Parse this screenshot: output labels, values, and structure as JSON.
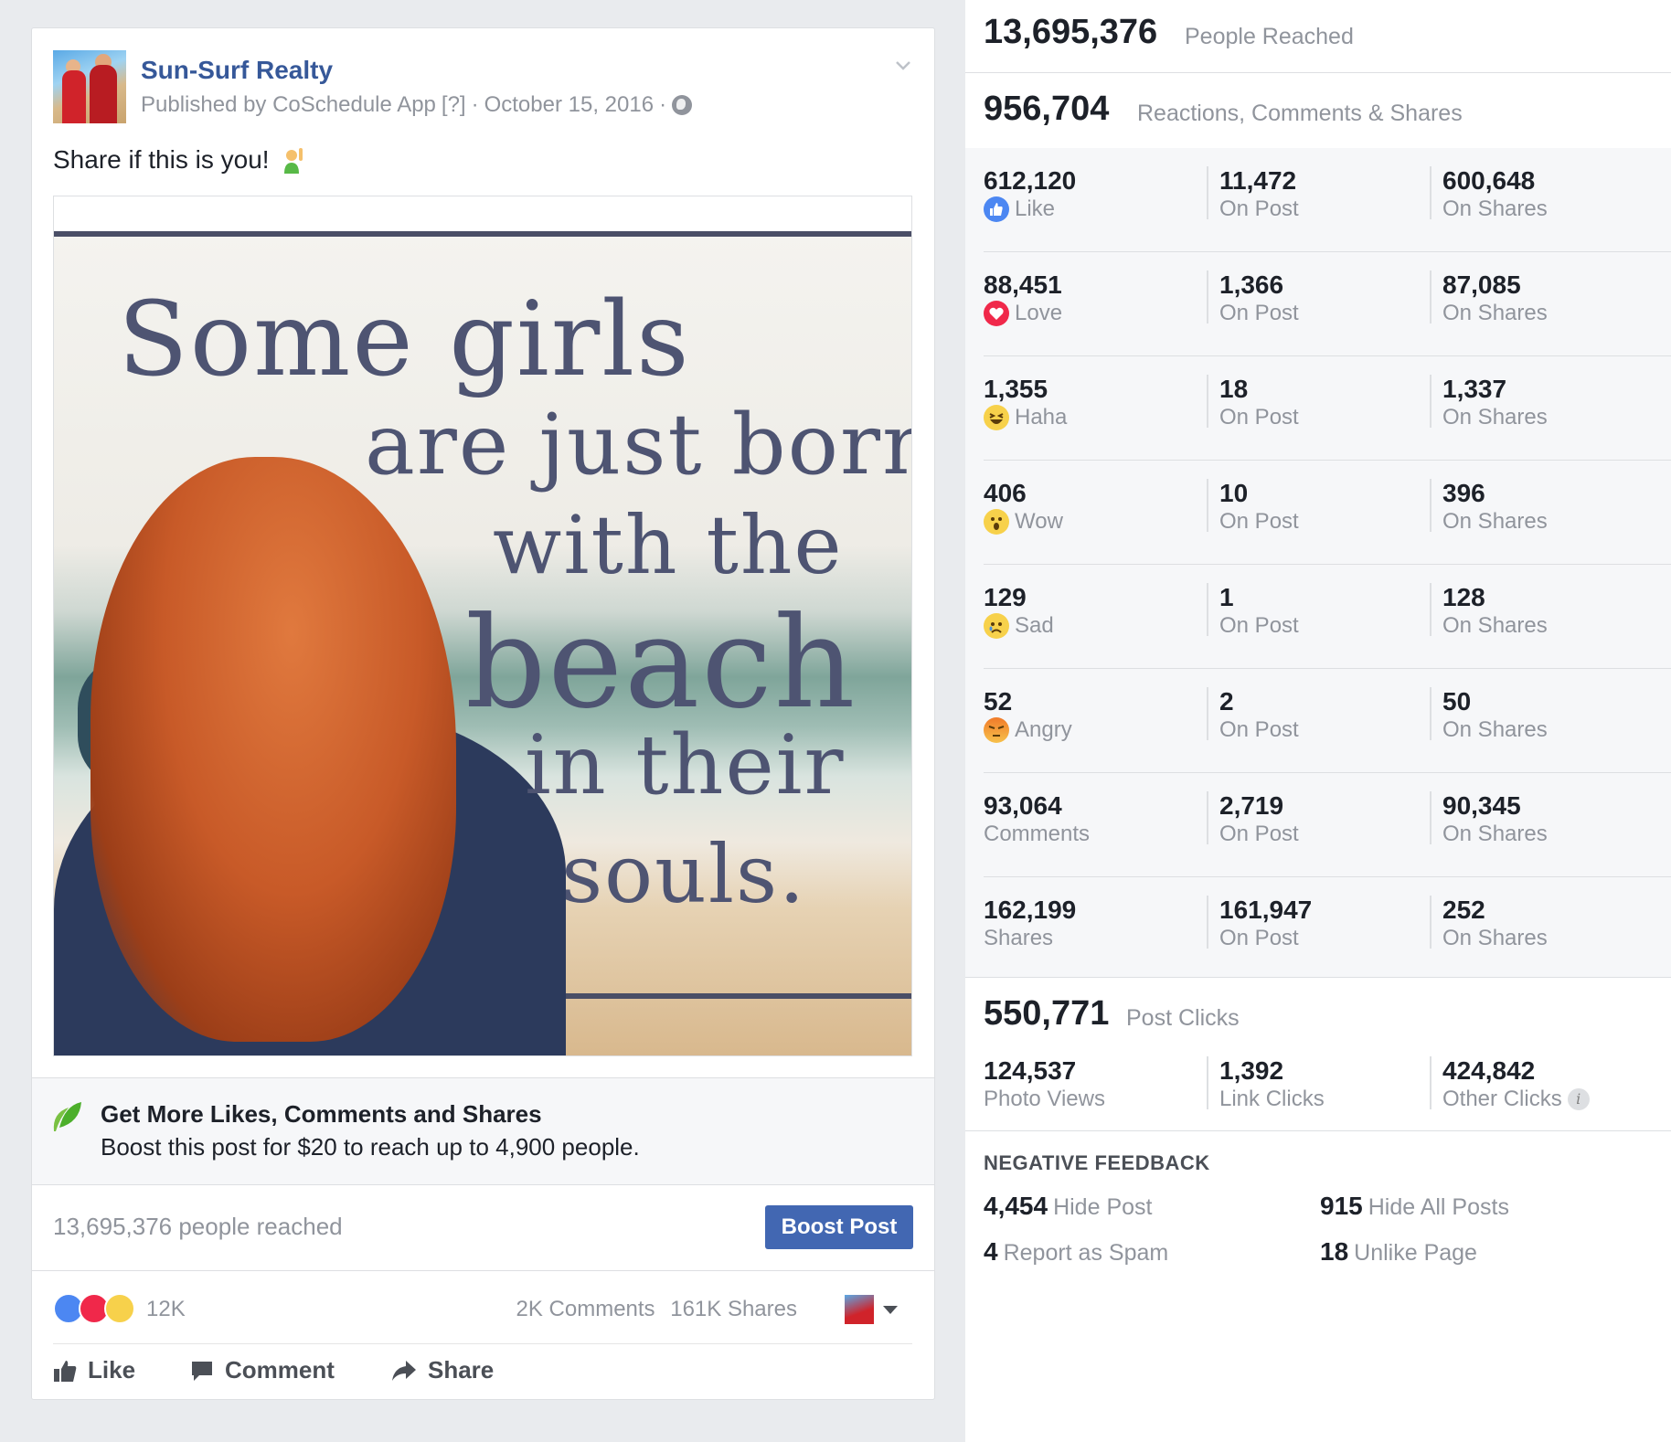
{
  "post": {
    "page_name": "Sun-Surf Realty",
    "meta_published": "Published by CoSchedule App",
    "meta_help": "[?]",
    "meta_date": "October 15, 2016",
    "meta_sep": "·",
    "text": "Share if this is you!",
    "image_quote": [
      "Some girls",
      "are just born",
      "with the",
      "beach",
      "in their",
      "souls."
    ],
    "promo_title": "Get More Likes, Comments and Shares",
    "promo_sub": "Boost this post for $20 to reach up to 4,900 people.",
    "reach_text": "13,695,376 people reached",
    "boost_label": "Boost Post",
    "reactions_count": "12K",
    "comments_count": "2K Comments",
    "shares_count": "161K Shares",
    "actions": {
      "like": "Like",
      "comment": "Comment",
      "share": "Share"
    }
  },
  "insights": {
    "people_reached": {
      "value": "13,695,376",
      "label": "People Reached"
    },
    "engagement": {
      "value": "956,704",
      "label": "Reactions, Comments & Shares"
    },
    "rows": [
      {
        "total": "612,120",
        "label": "Like",
        "icon": "like-icon",
        "on_post": "11,472",
        "on_shares": "600,648"
      },
      {
        "total": "88,451",
        "label": "Love",
        "icon": "love-icon",
        "on_post": "1,366",
        "on_shares": "87,085"
      },
      {
        "total": "1,355",
        "label": "Haha",
        "icon": "haha-icon",
        "on_post": "18",
        "on_shares": "1,337"
      },
      {
        "total": "406",
        "label": "Wow",
        "icon": "wow-icon",
        "on_post": "10",
        "on_shares": "396"
      },
      {
        "total": "129",
        "label": "Sad",
        "icon": "sad-icon",
        "on_post": "1",
        "on_shares": "128"
      },
      {
        "total": "52",
        "label": "Angry",
        "icon": "angry-icon",
        "on_post": "2",
        "on_shares": "50"
      },
      {
        "total": "93,064",
        "label": "Comments",
        "icon": "",
        "on_post": "2,719",
        "on_shares": "90,345"
      },
      {
        "total": "162,199",
        "label": "Shares",
        "icon": "",
        "on_post": "161,947",
        "on_shares": "252"
      }
    ],
    "on_post_label": "On Post",
    "on_shares_label": "On Shares",
    "post_clicks": {
      "value": "550,771",
      "label": "Post Clicks"
    },
    "clicks": [
      {
        "value": "124,537",
        "label": "Photo Views"
      },
      {
        "value": "1,392",
        "label": "Link Clicks"
      },
      {
        "value": "424,842",
        "label": "Other Clicks"
      }
    ],
    "info_glyph": "i",
    "negative_title": "NEGATIVE FEEDBACK",
    "negative": [
      {
        "value": "4,454",
        "label": "Hide Post"
      },
      {
        "value": "915",
        "label": "Hide All Posts"
      },
      {
        "value": "4",
        "label": "Report as Spam"
      },
      {
        "value": "18",
        "label": "Unlike Page"
      }
    ]
  },
  "colors": {
    "link_blue": "#365899",
    "button_blue": "#4267b2",
    "like_blue": "#4c87f2",
    "love_red": "#f0284a",
    "emoji_yellow": "#f7d14b",
    "angry_orange": "#f07a2a",
    "muted_text": "#90949c"
  }
}
